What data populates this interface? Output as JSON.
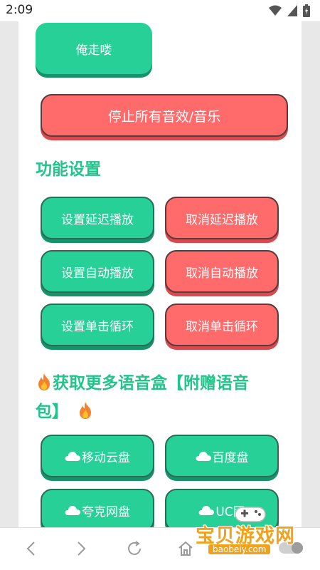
{
  "status": {
    "time": "2:09"
  },
  "buttons": {
    "leave": "俺走喽",
    "stop_all": "停止所有音效/音乐"
  },
  "function_settings": {
    "title": "功能设置",
    "set_delay": "设置延迟播放",
    "cancel_delay": "取消延迟播放",
    "set_autoplay": "设置自动播放",
    "cancel_autoplay": "取消自动播放",
    "set_loop": "设置单击循环",
    "cancel_loop": "取消单击循环"
  },
  "more_boxes": {
    "title_line1": "获取更多语音盒【附赠语音",
    "title_line2": "包】",
    "mobile_cloud": "移动云盘",
    "baidu": "百度盘",
    "quark": "夸克网盘",
    "uc": "UC网"
  },
  "watermark": {
    "text": "宝贝游戏网",
    "url": "baobeiy.com"
  },
  "colors": {
    "green": "#26d096",
    "red": "#ff6b6b",
    "title_green": "#22c48c"
  },
  "icons": [
    "wifi-icon",
    "signal-icon",
    "battery-icon",
    "fire-icon",
    "cloud-icon",
    "back-icon",
    "forward-icon",
    "refresh-icon",
    "home-icon"
  ]
}
